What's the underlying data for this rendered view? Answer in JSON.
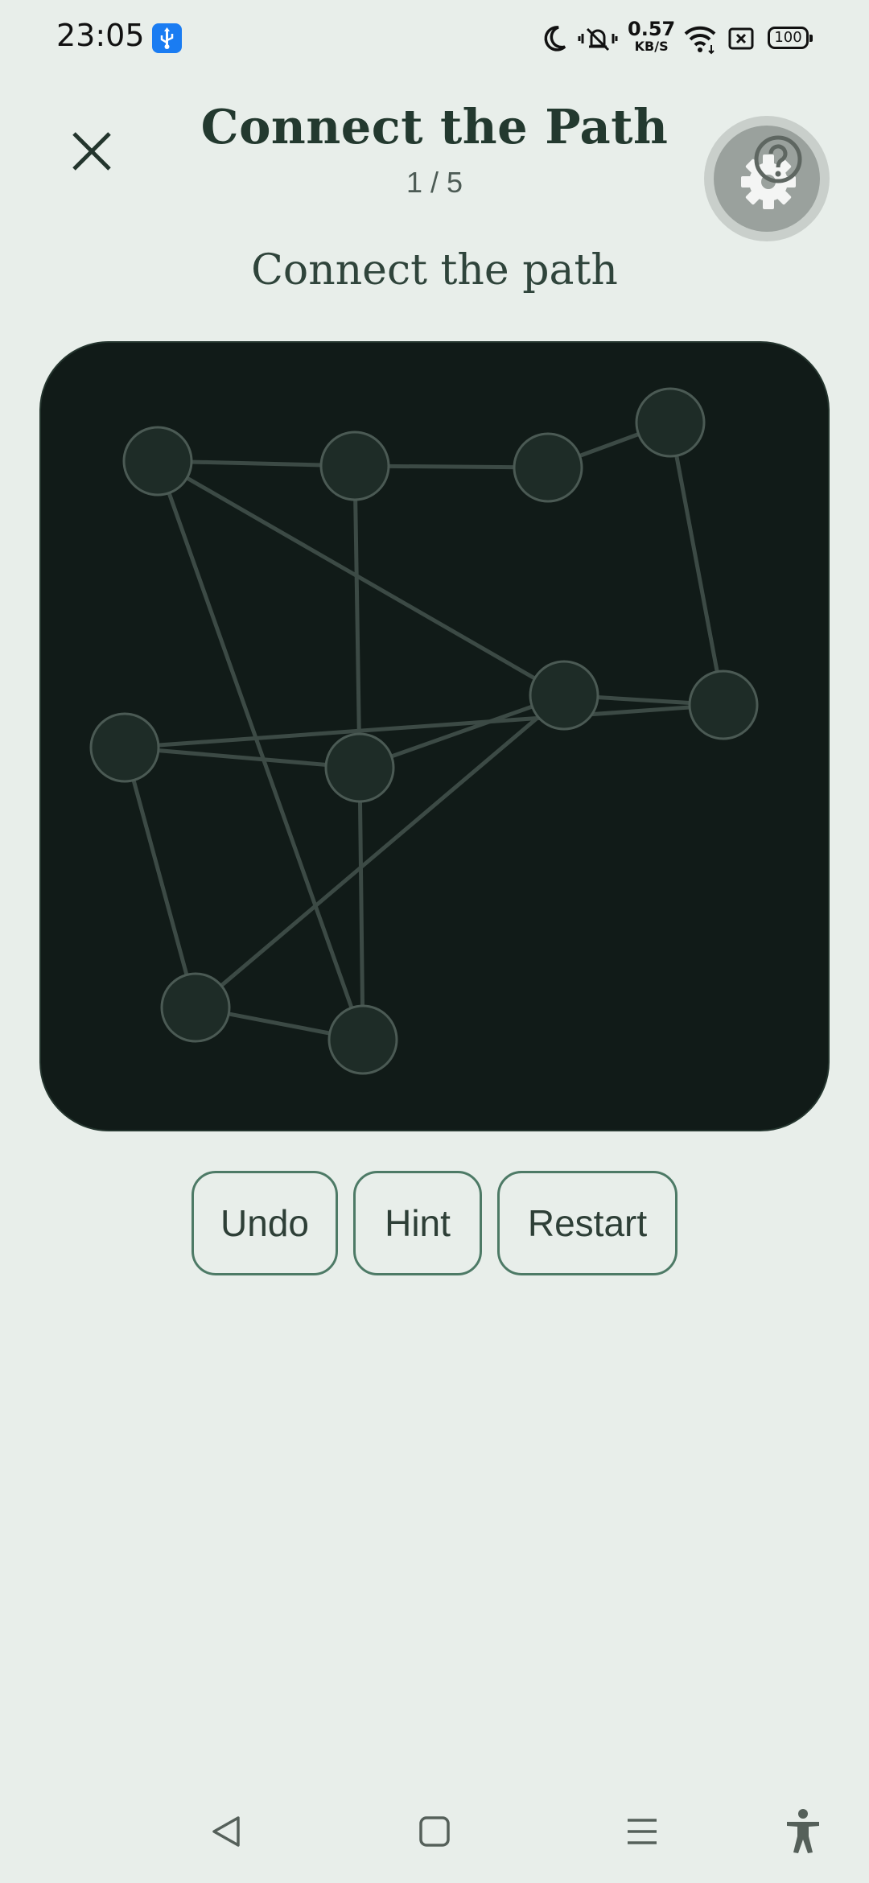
{
  "status_bar": {
    "time": "23:05",
    "net_speed_value": "0.57",
    "net_speed_unit": "KB/S",
    "battery": "100",
    "icons": [
      "usb-icon",
      "moon-icon",
      "vibrate-off-icon",
      "wifi-icon",
      "sim-off-icon",
      "battery-icon"
    ]
  },
  "header": {
    "title": "Connect the Path",
    "level": "1 / 5",
    "close_icon": "close-icon",
    "help_icon": "help-settings-icon"
  },
  "puzzle": {
    "prompt": "Connect the path",
    "node_color": "#1e2c27",
    "node_stroke": "#4b5a54",
    "edge_color": "#3c4a45",
    "board_color": "#111b18"
  },
  "controls": {
    "undo_label": "Undo",
    "hint_label": "Hint",
    "restart_label": "Restart"
  },
  "nav_bar": {
    "icons": [
      "back-icon",
      "home-icon",
      "recents-icon",
      "accessibility-icon"
    ]
  },
  "colors": {
    "background": "#e8eeea",
    "accent": "#4d7a66",
    "title": "#23392f"
  }
}
